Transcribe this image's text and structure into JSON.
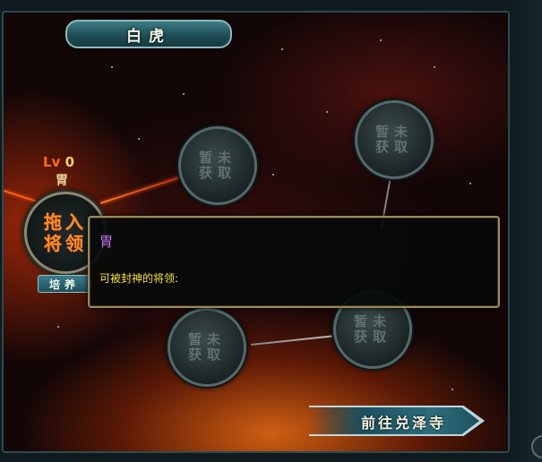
{
  "header": {
    "title": "白虎"
  },
  "main_node": {
    "level_prefix": "Lv",
    "level_value": "0",
    "name": "胃",
    "placeholder_text": "拖入将领"
  },
  "locked_node": {
    "label": "暂未获取"
  },
  "train_button": {
    "label": "培养"
  },
  "tooltip": {
    "title": "胃",
    "body": "可被封神的将领:"
  },
  "goto_button": {
    "label": "前往兑泽寺"
  },
  "colors": {
    "title_bar": "#2d6b74",
    "tooltip_title": "#c070f0",
    "tooltip_body": "#f0e04a",
    "level_prefix": "#ff6a20",
    "node_placeholder": "#ff8c20"
  }
}
